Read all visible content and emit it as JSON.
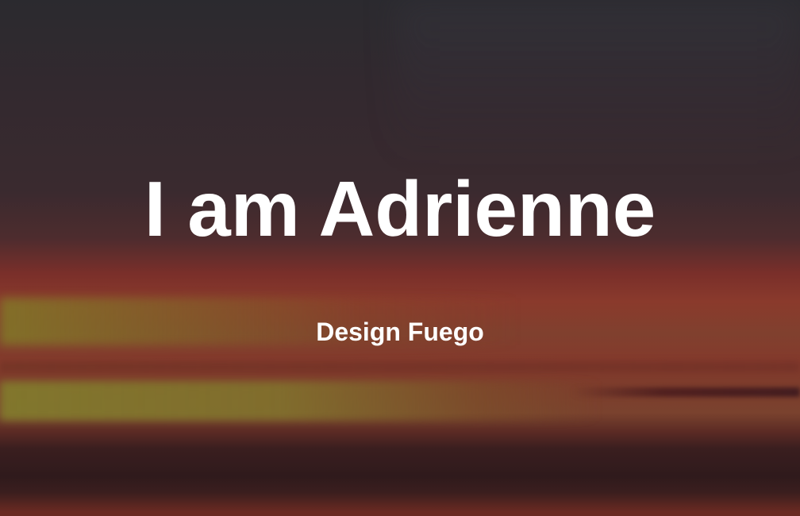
{
  "hero": {
    "title": "I am Adrienne",
    "subtitle": "Design Fuego"
  },
  "colors": {
    "text": "#ffffff",
    "sky_dark": "#2b2a2f",
    "sunset_red": "#8a3a2c",
    "sunset_yellow": "#82782a"
  }
}
